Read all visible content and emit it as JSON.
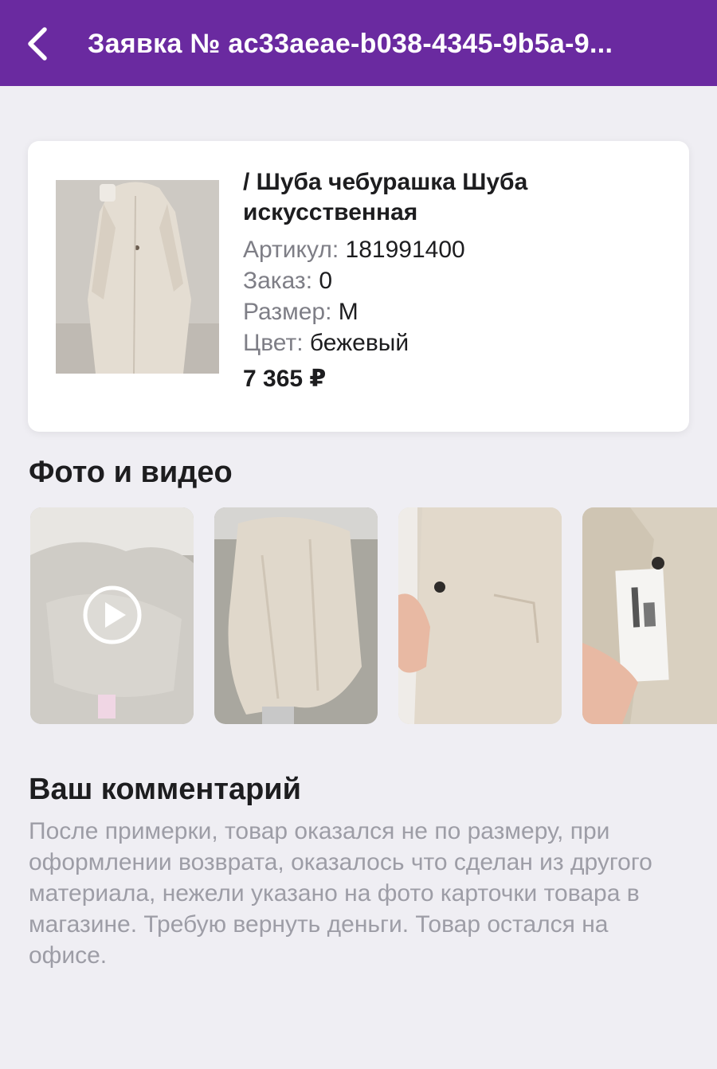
{
  "header": {
    "title": "Заявка № ac33aeae-b038-4345-9b5a-9...",
    "back_icon": "chevron-left-icon",
    "bg_color": "#6a2aa0"
  },
  "product": {
    "name": "/ Шуба чебурашка Шуба искусственная",
    "article_label": "Артикул:",
    "article_value": "181991400",
    "order_label": "Заказ:",
    "order_value": "0",
    "size_label": "Размер:",
    "size_value": "M",
    "color_label": "Цвет:",
    "color_value": "бежевый",
    "price": "7 365 ₽"
  },
  "media": {
    "title": "Фото и видео",
    "items": [
      {
        "type": "video",
        "icon": "play-icon"
      },
      {
        "type": "photo"
      },
      {
        "type": "photo"
      },
      {
        "type": "photo"
      }
    ]
  },
  "comment": {
    "title": "Ваш комментарий",
    "text": "После примерки, товар оказался не по размеру, при оформлении возврата, оказалось что сделан из другого материала, нежели указано на фото карточки товара в магазине. Требую вернуть деньги. Товар остался на офисе."
  }
}
